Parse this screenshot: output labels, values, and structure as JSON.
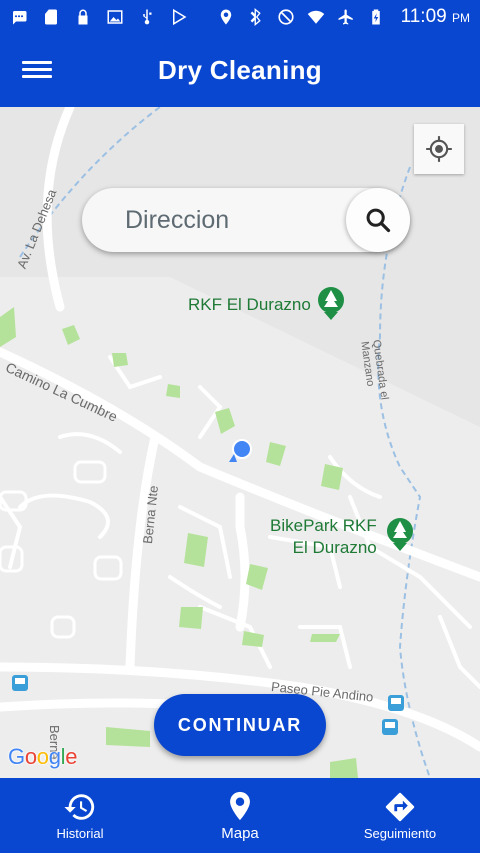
{
  "status_bar": {
    "time": "11:09",
    "ampm": "PM",
    "left_icons": [
      "message-icon",
      "sd-card-icon",
      "lock-icon",
      "image-icon",
      "usb-icon",
      "play-store-icon"
    ],
    "right_icons": [
      "location-icon",
      "bluetooth-icon",
      "do-not-disturb-icon",
      "wifi-icon",
      "airplane-icon",
      "battery-charging-icon"
    ]
  },
  "app_bar": {
    "title": "Dry Cleaning",
    "menu_icon": "hamburger-menu-icon"
  },
  "search": {
    "placeholder": "Direccion",
    "value": "",
    "icon": "search-icon"
  },
  "map": {
    "street_labels": {
      "dehesa": "Av. La Dehesa",
      "cumbre": "Camino La Cumbre",
      "berna": "Berna Nte",
      "quebrada": "Quebrada el Manzano",
      "paseo": "Paseo Pie Andino",
      "berna2": "Berna",
      "side": "Ri"
    },
    "pois": {
      "durazno": "RKF El Durazno",
      "bikepark_line1": "BikePark RKF",
      "bikepark_line2": "El Durazno"
    },
    "attribution": "Google",
    "locate_icon": "my-location-icon"
  },
  "continue_button": {
    "label": "CONTINUAR"
  },
  "bottom_nav": {
    "items": [
      {
        "label": "Historial",
        "icon": "history-icon",
        "active": false
      },
      {
        "label": "Mapa",
        "icon": "map-pin-icon",
        "active": true
      },
      {
        "label": "Seguimiento",
        "icon": "directions-icon",
        "active": false
      }
    ]
  },
  "colors": {
    "primary": "#0a47d1",
    "poi_green": "#1f7a36",
    "park_green": "#b5e29a",
    "user_location": "#4285f4"
  }
}
